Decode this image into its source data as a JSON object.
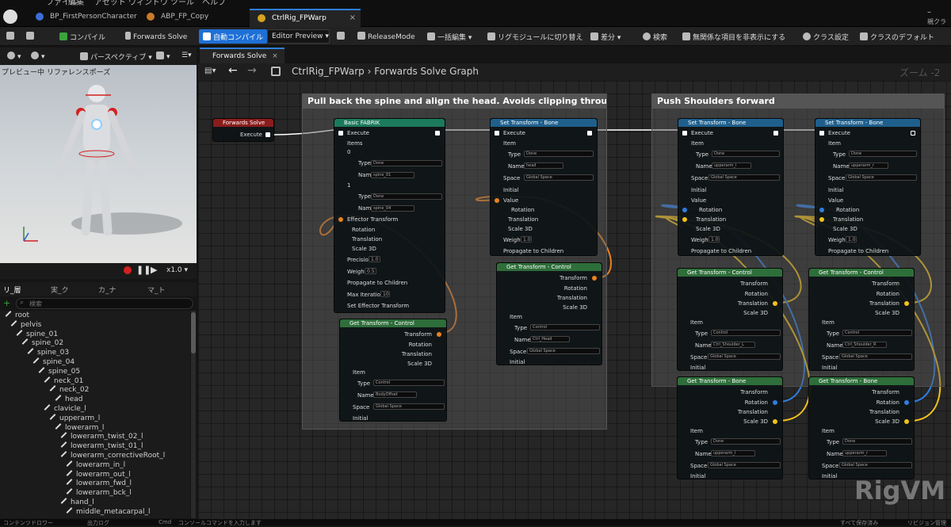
{
  "menu": {
    "items": [
      "ファイル",
      "編集",
      "アセット",
      "ウィンドウ",
      "ツール",
      "ヘルプ"
    ]
  },
  "doc_tabs": [
    {
      "label": "BP_FirstPersonCharacter"
    },
    {
      "label": "ABP_FP_Copy"
    },
    {
      "label": "CtrlRig_FPWarp"
    }
  ],
  "window": {
    "parent_label": "親クラ"
  },
  "toolbar": {
    "compile": "コンパイル",
    "forwards_solve": "Forwards Solve",
    "auto_compile": "自動コンパイル",
    "editor_preview": "Editor Preview",
    "release_mode": "ReleaseMode",
    "bulk_edit": "一括編集",
    "rig_module": "リグモジュールに切り替え",
    "diff": "差分",
    "search": "検索",
    "hide_unrelated": "無関係な項目を非表示にする",
    "class_settings": "クラス設定",
    "class_defaults": "クラスのデフォルト"
  },
  "viewport": {
    "perspective": "パースペクティブ",
    "label": "プレビュー中 リファレンスポーズ",
    "speed": "x1.0"
  },
  "outliner": {
    "tabs": [
      "リ_層",
      "実_ク",
      "カ_ナ",
      "マ_ト"
    ],
    "search_placeholder": "検索",
    "items": [
      {
        "label": "root",
        "depth": 0
      },
      {
        "label": "pelvis",
        "depth": 1
      },
      {
        "label": "spine_01",
        "depth": 2
      },
      {
        "label": "spine_02",
        "depth": 3
      },
      {
        "label": "spine_03",
        "depth": 4
      },
      {
        "label": "spine_04",
        "depth": 5
      },
      {
        "label": "spine_05",
        "depth": 6
      },
      {
        "label": "neck_01",
        "depth": 7
      },
      {
        "label": "neck_02",
        "depth": 8
      },
      {
        "label": "head",
        "depth": 9
      },
      {
        "label": "clavicle_l",
        "depth": 7
      },
      {
        "label": "upperarm_l",
        "depth": 8
      },
      {
        "label": "lowerarm_l",
        "depth": 9
      },
      {
        "label": "lowerarm_twist_02_l",
        "depth": 10
      },
      {
        "label": "lowerarm_twist_01_l",
        "depth": 10
      },
      {
        "label": "lowerarm_correctiveRoot_l",
        "depth": 10
      },
      {
        "label": "lowerarm_in_l",
        "depth": 11
      },
      {
        "label": "lowerarm_out_l",
        "depth": 11
      },
      {
        "label": "lowerarm_fwd_l",
        "depth": 11
      },
      {
        "label": "lowerarm_bck_l",
        "depth": 11
      },
      {
        "label": "hand_l",
        "depth": 10
      },
      {
        "label": "middle_metacarpal_l",
        "depth": 11
      }
    ]
  },
  "graph": {
    "tab_label": "Forwards Solve",
    "breadcrumb_asset": "CtrlRig_FPWarp",
    "breadcrumb_graph": "Forwards Solve Graph",
    "zoom": "ズーム -2",
    "watermark": "RigVM",
    "comments": [
      {
        "title": "Pull back the spine and align the head. Avoids clipping through the"
      },
      {
        "title": "Push Shoulders forward"
      }
    ]
  },
  "nodes": {
    "forwards_solve": {
      "title": "Forwards Solve",
      "execute": "Execute"
    },
    "fabrik": {
      "title": "Basic FABRIK",
      "execute": "Execute",
      "items": "Items",
      "item0_index": "0",
      "item0_type": "Done",
      "item0_name": "spine_01",
      "item1_index": "1",
      "item1_type": "Done",
      "item1_name": "spine_04",
      "effector": "Effector Transform",
      "rotation": "Rotation",
      "translation": "Translation",
      "scale": "Scale 3D",
      "precision_label": "Precision",
      "precision": "1.0",
      "weight_label": "Weight",
      "weight": "0.5",
      "propagate": "Propagate to Children",
      "max_iter_label": "Max Iterations",
      "max_iter": "10",
      "set_effector": "Set Effector Transform",
      "type_label": "Type",
      "name_label": "Name"
    },
    "get_body": {
      "title": "Get Transform - Control",
      "transform": "Transform",
      "rotation": "Rotation",
      "translation": "Translation",
      "scale": "Scale 3D",
      "item": "Item",
      "type_label": "Type",
      "type": "Control",
      "name_label": "Name",
      "name": "BodyOffset",
      "space_label": "Space",
      "space": "Global Space",
      "initial": "Initial"
    },
    "set_head": {
      "title": "Set Transform - Bone",
      "execute": "Execute",
      "item": "Item",
      "type_label": "Type",
      "type": "Done",
      "name_label": "Name",
      "name": "head",
      "space_label": "Space",
      "space": "Global Space",
      "initial": "Initial",
      "value": "Value",
      "rotation": "Rotation",
      "translation": "Translation",
      "scale": "Scale 3D",
      "weight_label": "Weight",
      "weight": "1.0",
      "propagate": "Propagate to Children"
    },
    "get_head": {
      "title": "Get Transform - Control",
      "transform": "Transform",
      "rotation": "Rotation",
      "translation": "Translation",
      "scale": "Scale 3D",
      "item": "Item",
      "type_label": "Type",
      "type": "Control",
      "name_label": "Name",
      "name": "Ctrl_Head",
      "space_label": "Space",
      "space": "Global Space",
      "initial": "Initial"
    },
    "set_upper_l": {
      "title": "Set Transform - Bone",
      "execute": "Execute",
      "item": "Item",
      "type_label": "Type",
      "type": "Done",
      "name_label": "Name",
      "name": "upperarm_l",
      "space_label": "Space",
      "space": "Global Space",
      "initial": "Initial",
      "value": "Value",
      "rotation": "Rotation",
      "translation": "Translation",
      "scale": "Scale 3D",
      "weight_label": "Weight",
      "weight": "1.0",
      "propagate": "Propagate to Children"
    },
    "set_upper_r": {
      "title": "Set Transform - Bone",
      "execute": "Execute",
      "item": "Item",
      "type_label": "Type",
      "type": "Done",
      "name_label": "Name",
      "name": "upperarm_r",
      "space_label": "Space",
      "space": "Global Space",
      "initial": "Initial",
      "value": "Value",
      "rotation": "Rotation",
      "translation": "Translation",
      "scale": "Scale 3D",
      "weight_label": "Weight",
      "weight": "1.0",
      "propagate": "Propagate to Children"
    },
    "get_shoulder_l": {
      "title": "Get Transform - Control",
      "transform": "Transform",
      "rotation": "Rotation",
      "translation": "Translation",
      "scale": "Scale 3D",
      "item": "Item",
      "type_label": "Type",
      "type": "Control",
      "name_label": "Name",
      "name": "Ctrl_Shoulder_L",
      "space_label": "Space",
      "space": "Global Space",
      "initial": "Initial"
    },
    "get_shoulder_r": {
      "title": "Get Transform - Control",
      "transform": "Transform",
      "rotation": "Rotation",
      "translation": "Translation",
      "scale": "Scale 3D",
      "item": "Item",
      "type_label": "Type",
      "type": "Control",
      "name_label": "Name",
      "name": "Ctrl_Shoulder_R",
      "space_label": "Space",
      "space": "Global Space",
      "initial": "Initial"
    },
    "get_bone_l": {
      "title": "Get Transform - Bone",
      "transform": "Transform",
      "rotation": "Rotation",
      "translation": "Translation",
      "scale": "Scale 3D",
      "item": "Item",
      "type_label": "Type",
      "type": "Done",
      "name_label": "Name",
      "name": "upperarm_l",
      "space_label": "Space",
      "space": "Global Space",
      "initial": "Initial"
    },
    "get_bone_r": {
      "title": "Get Transform - Bone",
      "transform": "Transform",
      "rotation": "Rotation",
      "translation": "Translation",
      "scale": "Scale 3D",
      "item": "Item",
      "type_label": "Type",
      "type": "Done",
      "name_label": "Name",
      "name": "upperarm_r",
      "space_label": "Space",
      "space": "Global Space",
      "initial": "Initial"
    }
  },
  "statusbar": {
    "content_drawer": "コンテンツドロワー",
    "output_log": "出力ログ",
    "cmd": "Cmd",
    "cmd_placeholder": "コンソールコマンドを入力します",
    "save": "すべて保存済み",
    "revision": "リビジョン管理"
  },
  "colors": {
    "accent": "#1f70d6",
    "exec_header": "#1c7a5c",
    "set_header": "#1f5f8c",
    "get_header": "#2e6e3a",
    "event_header": "#8b1c1c",
    "wire_orange": "#e8811f",
    "wire_yellow": "#f2c21b",
    "wire_blue": "#2f7ee0"
  }
}
